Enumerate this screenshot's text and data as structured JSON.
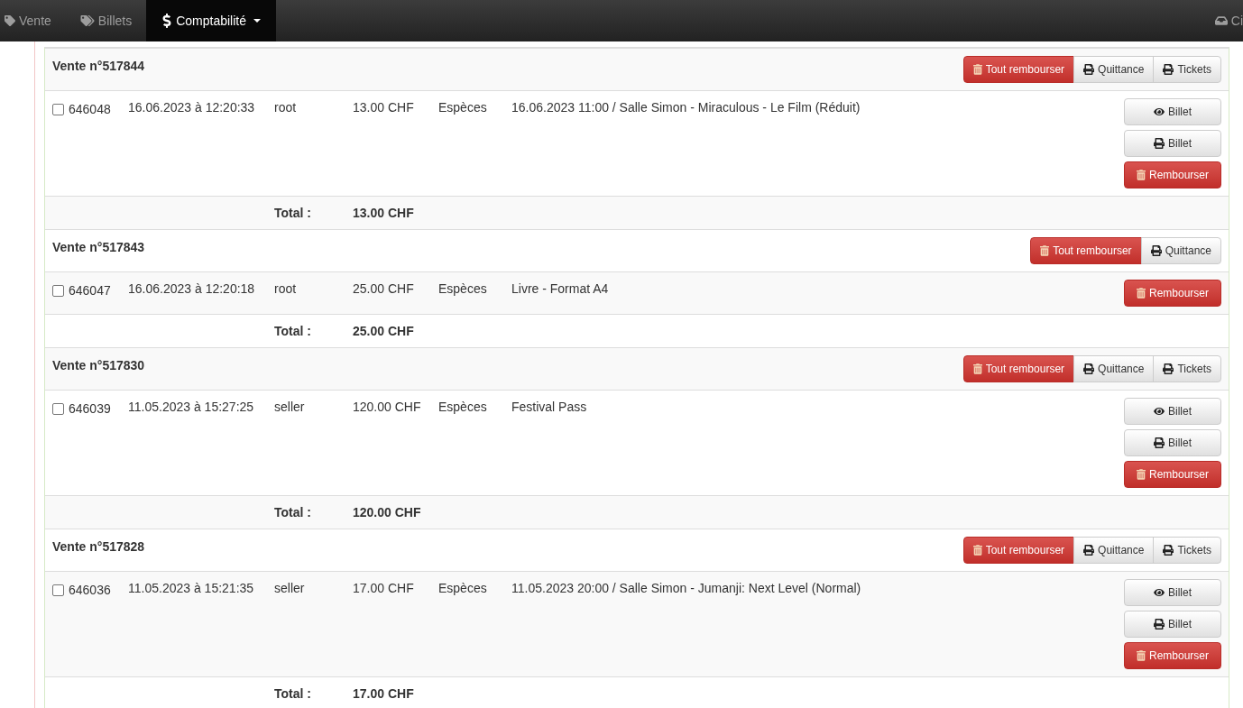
{
  "navbar": {
    "items": [
      {
        "label": "Vente",
        "kind": "tag",
        "selected": false,
        "dropdown": false
      },
      {
        "label": "Billets",
        "kind": "tags",
        "selected": false,
        "dropdown": false
      },
      {
        "label": "Comptabilité",
        "kind": "dollar",
        "selected": true,
        "dropdown": true
      }
    ],
    "right_item": {
      "label": "Ci",
      "kind": "inbox"
    }
  },
  "sales": [
    {
      "title": "Vente n°517844",
      "actions": [
        {
          "kind": "refund",
          "label": "Tout rembourser"
        },
        {
          "kind": "print",
          "label": "Quittance"
        },
        {
          "kind": "print",
          "label": "Tickets"
        }
      ],
      "items": [
        {
          "checked": false,
          "id": "646048",
          "date": "16.06.2023 à 12:20:33",
          "user": "root",
          "amount": "13.00 CHF",
          "payment": "Espèces",
          "description": "16.06.2023 11:00 / Salle Simon - Miraculous - Le Film (Réduit)",
          "actions": [
            {
              "kind": "view",
              "label": "Billet"
            },
            {
              "kind": "print",
              "label": "Billet"
            },
            {
              "kind": "refund",
              "label": "Rembourser"
            }
          ]
        }
      ],
      "total_label": "Total :",
      "total": "13.00 CHF"
    },
    {
      "title": "Vente n°517843",
      "actions": [
        {
          "kind": "refund",
          "label": "Tout rembourser"
        },
        {
          "kind": "print",
          "label": "Quittance"
        }
      ],
      "items": [
        {
          "checked": false,
          "id": "646047",
          "date": "16.06.2023 à 12:20:18",
          "user": "root",
          "amount": "25.00 CHF",
          "payment": "Espèces",
          "description": "Livre - Format A4",
          "actions": [
            {
              "kind": "refund",
              "label": "Rembourser"
            }
          ]
        }
      ],
      "total_label": "Total :",
      "total": "25.00 CHF"
    },
    {
      "title": "Vente n°517830",
      "actions": [
        {
          "kind": "refund",
          "label": "Tout rembourser"
        },
        {
          "kind": "print",
          "label": "Quittance"
        },
        {
          "kind": "print",
          "label": "Tickets"
        }
      ],
      "items": [
        {
          "checked": false,
          "id": "646039",
          "date": "11.05.2023 à 15:27:25",
          "user": "seller",
          "amount": "120.00 CHF",
          "payment": "Espèces",
          "description": "Festival Pass",
          "actions": [
            {
              "kind": "view",
              "label": "Billet"
            },
            {
              "kind": "print",
              "label": "Billet"
            },
            {
              "kind": "refund",
              "label": "Rembourser"
            }
          ]
        }
      ],
      "total_label": "Total :",
      "total": "120.00 CHF"
    },
    {
      "title": "Vente n°517828",
      "actions": [
        {
          "kind": "refund",
          "label": "Tout rembourser"
        },
        {
          "kind": "print",
          "label": "Quittance"
        },
        {
          "kind": "print",
          "label": "Tickets"
        }
      ],
      "items": [
        {
          "checked": false,
          "id": "646036",
          "date": "11.05.2023 à 15:21:35",
          "user": "seller",
          "amount": "17.00 CHF",
          "payment": "Espèces",
          "description": "11.05.2023 20:00 / Salle Simon - Jumanji: Next Level (Normal)",
          "actions": [
            {
              "kind": "view",
              "label": "Billet"
            },
            {
              "kind": "print",
              "label": "Billet"
            },
            {
              "kind": "refund",
              "label": "Rembourser"
            }
          ]
        }
      ],
      "total_label": "Total :",
      "total": "17.00 CHF"
    }
  ]
}
